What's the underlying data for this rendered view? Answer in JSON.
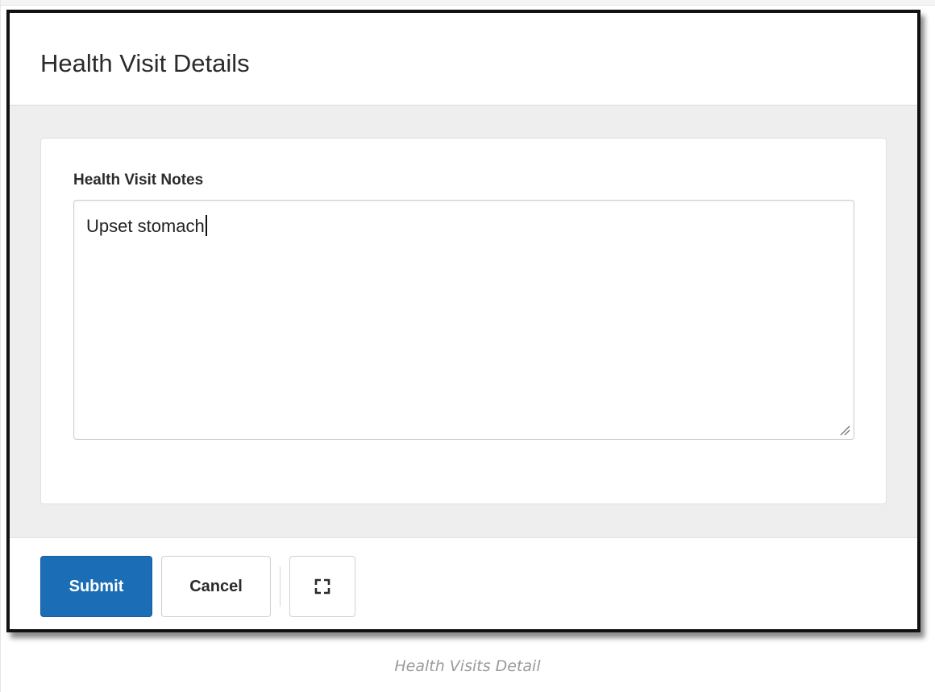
{
  "dialog": {
    "title": "Health Visit Details"
  },
  "form": {
    "notes_label": "Health Visit Notes",
    "notes_value": "Upset stomach"
  },
  "footer": {
    "submit_label": "Submit",
    "cancel_label": "Cancel",
    "expand_icon": "expand-icon"
  },
  "caption": "Health Visits Detail",
  "colors": {
    "submit_bg": "#1b6db5",
    "body_bg": "#eeeeee",
    "border": "#111111"
  }
}
